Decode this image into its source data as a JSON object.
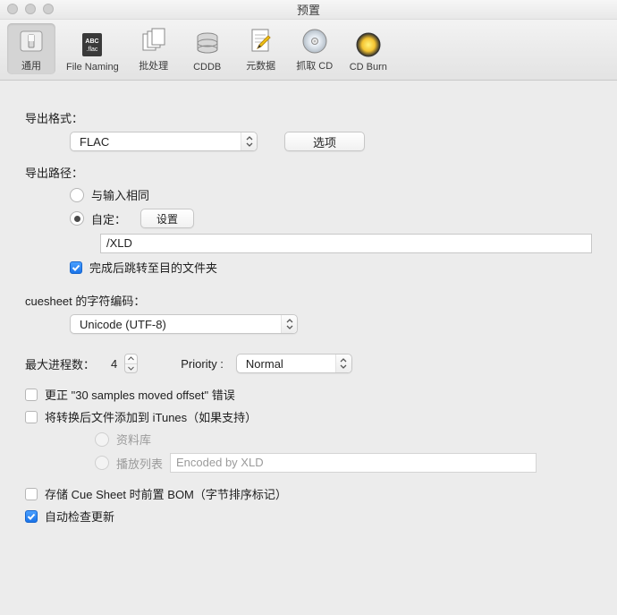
{
  "window": {
    "title": "预置"
  },
  "toolbar": {
    "items": [
      {
        "label": "通用"
      },
      {
        "label": "File Naming"
      },
      {
        "label": "批处理"
      },
      {
        "label": "CDDB"
      },
      {
        "label": "元数据"
      },
      {
        "label": "抓取 CD"
      },
      {
        "label": "CD Burn"
      }
    ]
  },
  "sections": {
    "output_format_label": "导出格式：",
    "output_format_value": "FLAC",
    "options_button": "选项",
    "output_path_label": "导出路径：",
    "same_as_input": "与输入相同",
    "custom_label": "自定：",
    "set_button": "设置",
    "custom_path": "/XLD",
    "open_after": "完成后跳转至目的文件夹",
    "cuesheet_label": "cuesheet 的字符编码：",
    "cuesheet_value": "Unicode (UTF-8)",
    "threads_label": "最大进程数：",
    "threads_value": "4",
    "priority_label": "Priority :",
    "priority_value": "Normal",
    "fix_offset": "更正 \"30 samples moved offset\" 错误",
    "add_itunes": "将转换后文件添加到 iTunes（如果支持）",
    "library": "资料库",
    "playlist": "播放列表",
    "playlist_placeholder": "Encoded by XLD",
    "bom": "存储 Cue Sheet 时前置 BOM（字节排序标记）",
    "auto_update": "自动检查更新"
  }
}
